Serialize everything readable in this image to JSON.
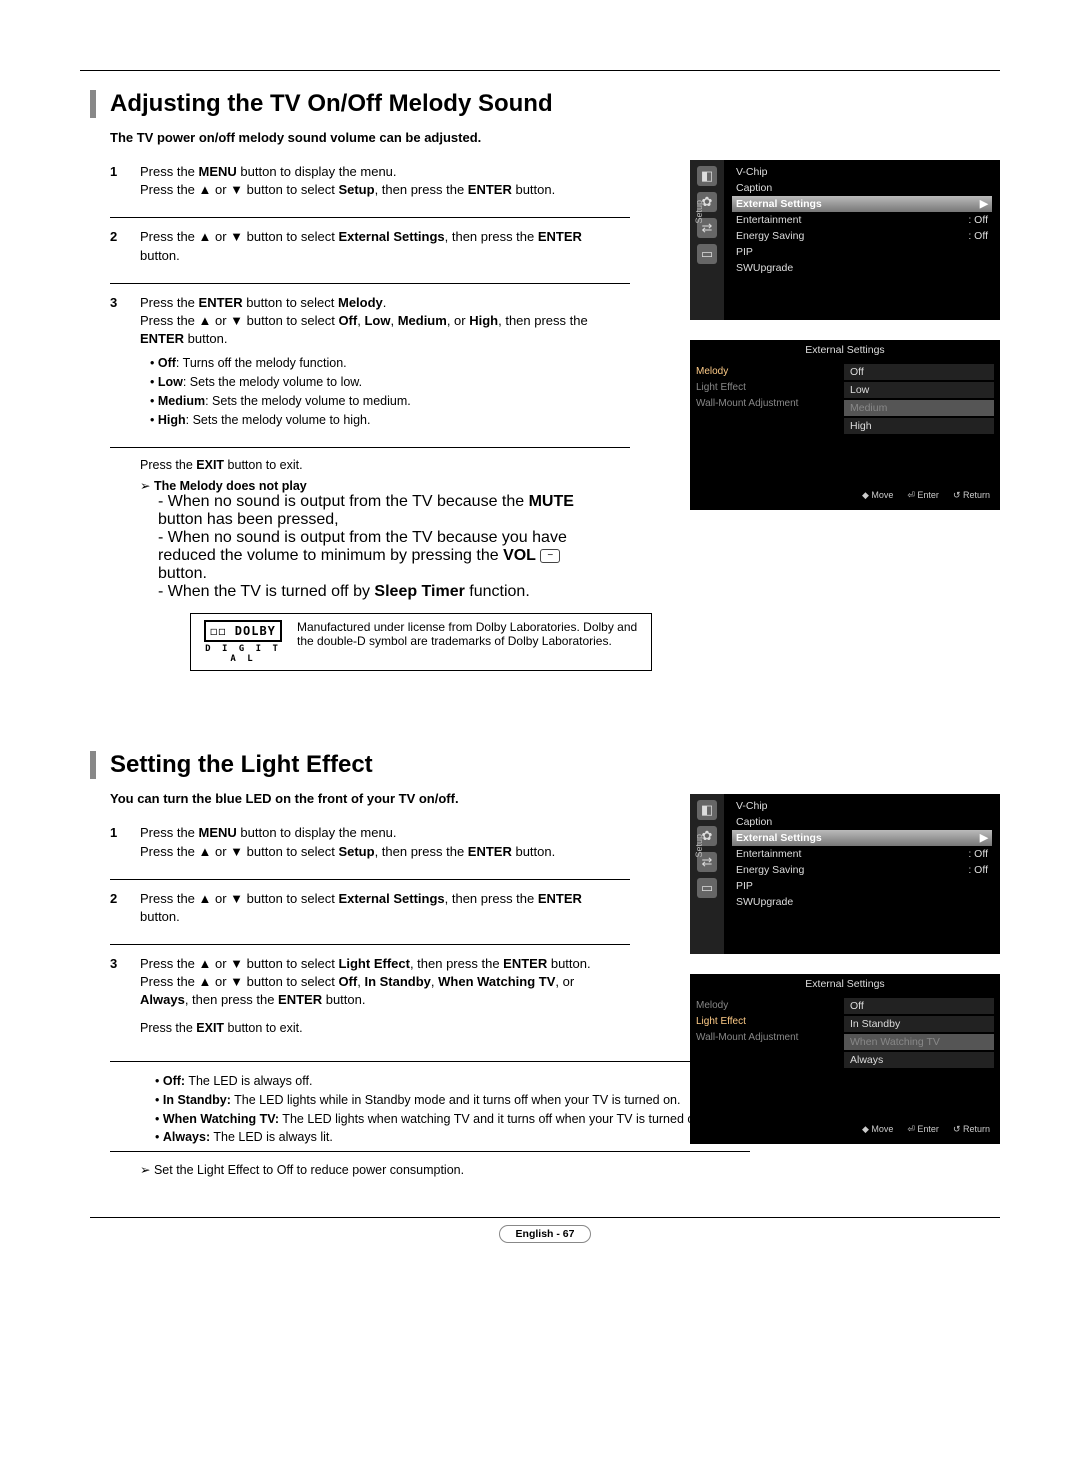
{
  "section1": {
    "title": "Adjusting the TV On/Off Melody Sound",
    "subtitle": "The TV power on/off melody sound volume can be adjusted.",
    "step1_a": "Press the ",
    "step1_b": "MENU",
    "step1_c": " button to display the menu.",
    "step1_d": "Press the ▲ or ▼ button to select ",
    "step1_e": "Setup",
    "step1_f": ", then press the ",
    "step1_g": "ENTER",
    "step1_h": " button.",
    "step2_a": "Press the ▲ or ▼ button to select ",
    "step2_b": "External Settings",
    "step2_c": ", then press the ",
    "step2_d": "ENTER",
    "step2_e": " button.",
    "step3_a": "Press the ",
    "step3_b": "ENTER",
    "step3_c": " button to select ",
    "step3_d": "Melody",
    "step3_e": ".",
    "step3_f": "Press the ▲ or ▼ button to select ",
    "step3_g": "Off",
    "step3_h": ", ",
    "step3_i": "Low",
    "step3_j": ", ",
    "step3_k": "Medium",
    "step3_l": ", or ",
    "step3_m": "High",
    "step3_n": ", then press the ",
    "step3_o": "ENTER",
    "step3_p": " button.",
    "b_off_l": "Off",
    "b_off_t": ": Turns off the melody function.",
    "b_low_l": "Low",
    "b_low_t": ": Sets the melody volume to low.",
    "b_med_l": "Medium",
    "b_med_t": ": Sets the melody volume to medium.",
    "b_high_l": "High",
    "b_high_t": ": Sets the melody volume to high.",
    "exit_a": "Press the ",
    "exit_b": "EXIT",
    "exit_c": " button to exit.",
    "note_title": "The Melody does not play",
    "note1_a": "When no sound is output from the TV because the ",
    "note1_b": "MUTE",
    "note1_c": " button has been pressed,",
    "note2_a": "When no sound is output from the TV because you have reduced the volume to minimum by pressing the ",
    "note2_b": "VOL",
    "note2_c": " button.",
    "note3_a": "When the TV is turned off by ",
    "note3_b": "Sleep Timer",
    "note3_c": " function.",
    "dolby": "Manufactured under license from Dolby Laboratories. Dolby and the double-D symbol are trademarks of Dolby Laboratories.",
    "dolby_logo_top": "◻◻ DOLBY",
    "dolby_logo_bottom": "D I G I T A L"
  },
  "section2": {
    "title": "Setting the Light Effect",
    "subtitle": "You can turn the blue LED on the front of your TV on/off.",
    "step1_a": "Press the ",
    "step1_b": "MENU",
    "step1_c": " button to display the menu.",
    "step1_d": "Press the ▲ or ▼ button to select ",
    "step1_e": "Setup",
    "step1_f": ", then press the ",
    "step1_g": "ENTER",
    "step1_h": " button.",
    "step2_a": "Press the ▲ or ▼ button to select ",
    "step2_b": "External Settings",
    "step2_c": ", then press the ",
    "step2_d": "ENTER",
    "step2_e": " button.",
    "step3_a": "Press the ▲ or ▼ button to select ",
    "step3_b": "Light Effect",
    "step3_c": ", then press the ",
    "step3_d": "ENTER",
    "step3_e": " button.",
    "step3_f": "Press the ▲ or ▼ button to select ",
    "step3_g": "Off",
    "step3_h": ", ",
    "step3_i": "In Standby",
    "step3_j": ", ",
    "step3_k": "When Watching TV",
    "step3_l": ", or ",
    "step3_m": "Always",
    "step3_n": ", then press the ",
    "step3_o": "ENTER",
    "step3_p": " button.",
    "exit_a": "Press the ",
    "exit_b": "EXIT",
    "exit_c": " button to exit.",
    "b_off_l": "Off:",
    "b_off_t": " The LED is always off.",
    "b_standby_l": "In Standby:",
    "b_standby_t": " The LED lights while in Standby mode and it turns off when your TV is turned on.",
    "b_watch_l": "When Watching TV:",
    "b_watch_t": " The LED lights when watching TV and it turns off when your TV is turned off.",
    "b_always_l": "Always:",
    "b_always_t": " The LED is always lit.",
    "tip": "Set the Light Effect to Off to reduce power consumption."
  },
  "osd": {
    "setup_label": "Setup",
    "menu_items": {
      "vchip": "V-Chip",
      "caption": "Caption",
      "external": "External Settings",
      "entertainment": "Entertainment",
      "entertainment_v": ": Off",
      "energy": "Energy Saving",
      "energy_v": ": Off",
      "pip": "PIP",
      "sw": "SWUpgrade"
    },
    "ext_header": "External Settings",
    "left_melody": "Melody",
    "left_light": "Light Effect",
    "left_wall": "Wall-Mount Adjustment",
    "melody_opts": {
      "off": "Off",
      "low": "Low",
      "medium": "Medium",
      "high": "High"
    },
    "light_opts": {
      "off": "Off",
      "standby": "In Standby",
      "watch": "When Watching TV",
      "always": "Always"
    },
    "footer_move": "Move",
    "footer_enter": "Enter",
    "footer_return": "Return"
  },
  "footer": "English - 67",
  "vol_key": "−"
}
